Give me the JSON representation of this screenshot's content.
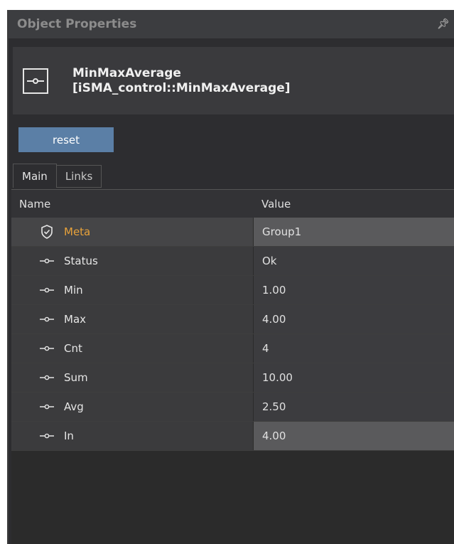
{
  "panel": {
    "title": "Object Properties",
    "pin_icon": "pin-icon"
  },
  "object": {
    "name": "MinMaxAverage",
    "type": "[iSMA_control::MinMaxAverage]",
    "icon": "component-icon"
  },
  "actions": {
    "reset_label": "reset"
  },
  "tabs": [
    {
      "label": "Main",
      "active": true
    },
    {
      "label": "Links",
      "active": false
    }
  ],
  "grid": {
    "columns": {
      "name": "Name",
      "value": "Value"
    },
    "rows": [
      {
        "name": "Meta",
        "value": "Group1",
        "icon": "shield-icon"
      },
      {
        "name": "Status",
        "value": "Ok",
        "icon": "slot-icon"
      },
      {
        "name": "Min",
        "value": "1.00",
        "icon": "slot-icon"
      },
      {
        "name": "Max",
        "value": "4.00",
        "icon": "slot-icon"
      },
      {
        "name": "Cnt",
        "value": "4",
        "icon": "slot-icon"
      },
      {
        "name": "Sum",
        "value": "10.00",
        "icon": "slot-icon"
      },
      {
        "name": "Avg",
        "value": "2.50",
        "icon": "slot-icon"
      },
      {
        "name": "In",
        "value": "4.00",
        "icon": "slot-icon"
      }
    ]
  },
  "colors": {
    "meta_label": "#e8a23a",
    "reset_button": "#5b7fa6",
    "panel_bg": "#2d2d30"
  }
}
